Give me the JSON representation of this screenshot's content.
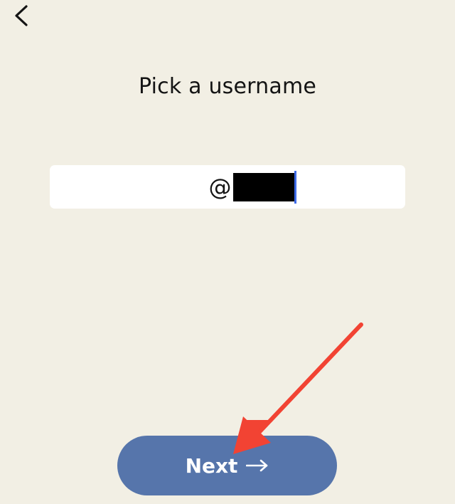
{
  "header": {
    "back_icon": "chevron-left-icon"
  },
  "page": {
    "title": "Pick a username"
  },
  "username": {
    "prefix": "@",
    "value": ""
  },
  "footer": {
    "next_label": "Next",
    "next_icon": "arrow-right-icon"
  },
  "colors": {
    "background": "#f2efe4",
    "button": "#5675ab",
    "caret": "#3d6ae8",
    "annotation_arrow": "#f24333"
  }
}
